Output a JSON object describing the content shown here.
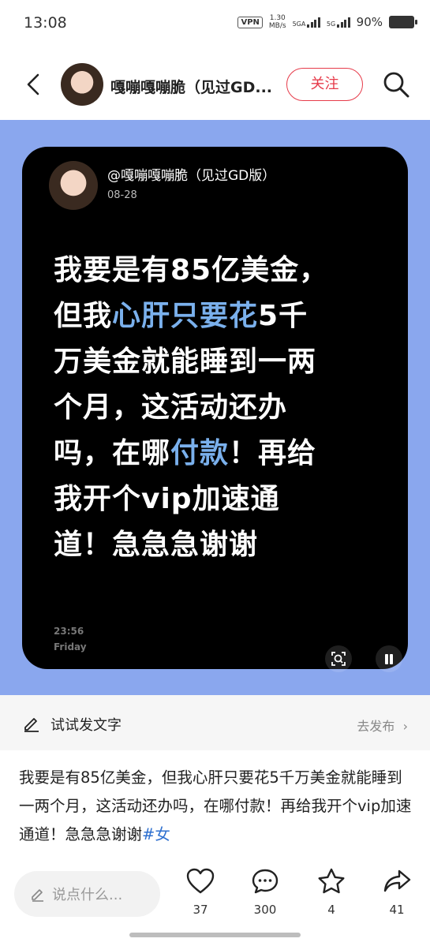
{
  "status_bar": {
    "time": "13:08",
    "vpn": "VPN",
    "speed_value": "1.30",
    "speed_unit": "MB/s",
    "signal1": "5GA",
    "signal2": "5G",
    "battery": "90%"
  },
  "header": {
    "author_name": "嘎嘣嘎嘣脆（见过GD...",
    "follow_label": "关注"
  },
  "post_card": {
    "handle": "@嘎嘣嘎嘣脆（见过GD版）",
    "date": "08-28",
    "text_1": "我要是有85亿美金，",
    "text_2": "但我",
    "text_hl_1": "心肝只要花",
    "text_3": "5千",
    "text_4": "万美金就能睡到一两",
    "text_5": "个月，这活动还办",
    "text_6": "吗，在哪",
    "text_hl_2": "付款",
    "text_7": "！再给",
    "text_8": "我开个vip加速通",
    "text_9": "道！急急急谢谢",
    "clock_time": "23:56",
    "clock_day": "Friday"
  },
  "try_row": {
    "label": "试试发文字",
    "action": "去发布"
  },
  "description": {
    "text": "我要是有85亿美金，但我心肝只要花5千万美金就能睡到一两个月，这活动还办吗，在哪付款！再给我开个vip加速通道！急急急谢谢",
    "tag": "#女"
  },
  "bottom_bar": {
    "comment_placeholder": "说点什么...",
    "like_count": "37",
    "comment_count": "300",
    "collect_count": "4",
    "share_count": "41"
  },
  "colors": {
    "accent": "#e63b4a",
    "highlight": "#7ab0ec",
    "media_bg": "#8aa7ee",
    "tag": "#2d6fcf"
  }
}
